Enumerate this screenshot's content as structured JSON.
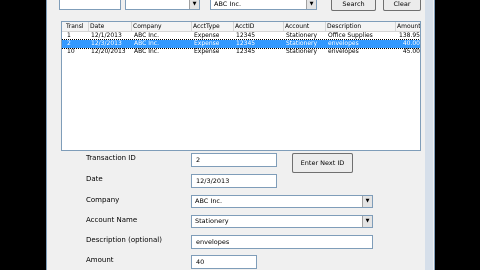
{
  "top": {
    "search_label": "Search",
    "clear_label": "Clear",
    "company_value": "ABC Inc."
  },
  "list": {
    "columns": [
      "Transl",
      "Date",
      "Company",
      "AcctType",
      "AcctID",
      "Account",
      "Description",
      "Amount"
    ],
    "rows": [
      [
        "1",
        "12/1/2013",
        "ABC Inc.",
        "Expense",
        "12345",
        "Stationery",
        "Office Supplies",
        "138.95"
      ],
      [
        "2",
        "12/3/2013",
        "ABC Inc.",
        "Expense",
        "12345",
        "Stationery",
        "envelopes",
        "40.00"
      ],
      [
        "10",
        "12/20/2013",
        "ABC Inc.",
        "Expense",
        "12345",
        "Stationery",
        "envelopes",
        "45.00"
      ]
    ],
    "selected_index": 1
  },
  "form": {
    "transaction_id_label": "Transaction ID",
    "transaction_id_value": "2",
    "enter_next_id_label": "Enter Next ID",
    "date_label": "Date",
    "date_value": "12/3/2013",
    "company_label": "Company",
    "company_value": "ABC Inc.",
    "account_name_label": "Account Name",
    "account_name_value": "Stationery",
    "description_label": "Description (optional)",
    "description_value": "envelopes",
    "amount_label": "Amount",
    "amount_value": "40"
  }
}
